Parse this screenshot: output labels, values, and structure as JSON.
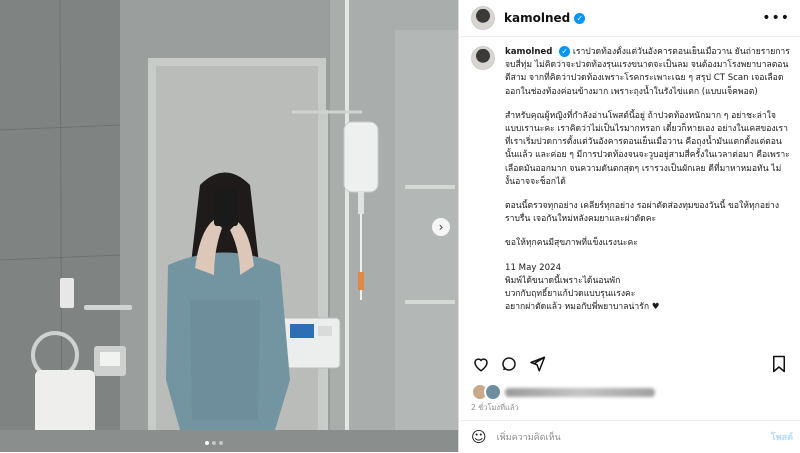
{
  "post": {
    "username": "kamolned",
    "verified_mark": "✓",
    "more_icon": "more-horizontal-icon"
  },
  "caption": {
    "username": "kamolned",
    "paragraphs": [
      "เราปวดท้องตั้งแต่วันอังคารตอนเย็นเมื่อวาน ยันถ่ายรายการจบสี่ทุ่ม ไม่คิดว่าจะปวดท้องรุนแรงขนาดจะเป็นลม จนต้องมาโรงพยาบาลตอนตีสาม จากที่คิดว่าปวดท้องเพราะโรคกระเพาะเฉย ๆ สรุป CT Scan เจอเลือดออกในช่องท้องค่อนข้างมาก เพราะถุงน้ำในรังไข่แตก (แบบแจ็คพอต)",
      "สำหรับคุณผู้หญิงที่กำลังอ่านโพสต์นี้อยู่ ถ้าปวดท้องหนักมาก ๆ อย่าชะล่าใจแบบเรานะคะ เราคิดว่าไม่เป็นไรมากหรอก เดี๋ยวก็หายเอง อย่างในเคสของเรา ที่เราเริ่มปวดการตั้งแต่วันอังคารตอนเย็นเมื่อวาน คือถุงน้ำมันแตกตั้งแต่ตอนนั้นแล้ว และค่อย ๆ มีการปวดท้องจนจะวูบอยู่สามสี่ครั้งในเวลาต่อมา คือเพราะเลือดมันออกมาก จนความดันตกสุดๆ เรารวงเป็นผักเลย ดีที่มาหาหมอทัน ไม่งั้นอาจจะช็อกได้",
      "ตอนนี้ตรวจทุกอย่าง เคลียร์ทุกอย่าง รอผ่าตัดส่องทุมของวันนี้ ขอให้ทุกอย่างราบรื่น เจอกันใหม่หลังคมยาและผ่าตัดคะ",
      "ขอให้ทุกคนมีสุขภาพที่แข็งแรงนะคะ",
      "11 May 2024\nพิมพ์ได้ขนาดนี้เพราะได้นอนพัก\nบวกกับฤทธิ์ยาแก้ปวดแบบรุนแรงคะ\nอยากผ่าตัดแล้ว หมอกับพี่พยาบาลน่ารัก ♥"
    ]
  },
  "actions": {
    "like_icon": "heart-icon",
    "comment_icon": "comment-icon",
    "share_icon": "share-icon",
    "save_icon": "bookmark-icon"
  },
  "likes": {
    "blurred": true
  },
  "timestamp": "2 ชั่วโมงที่แล้ว",
  "comment_box": {
    "placeholder": "เพิ่มความคิดเห็น",
    "post_label": "โพสต์",
    "emoji_icon": "smile-icon"
  },
  "carousel": {
    "next_icon": "chevron-right-icon",
    "slide_count": 3,
    "active_slide": 0
  },
  "colors": {
    "verified": "#0095f6",
    "post_button_disabled": "#b3dbff",
    "muted_text": "#8e8e8e"
  }
}
